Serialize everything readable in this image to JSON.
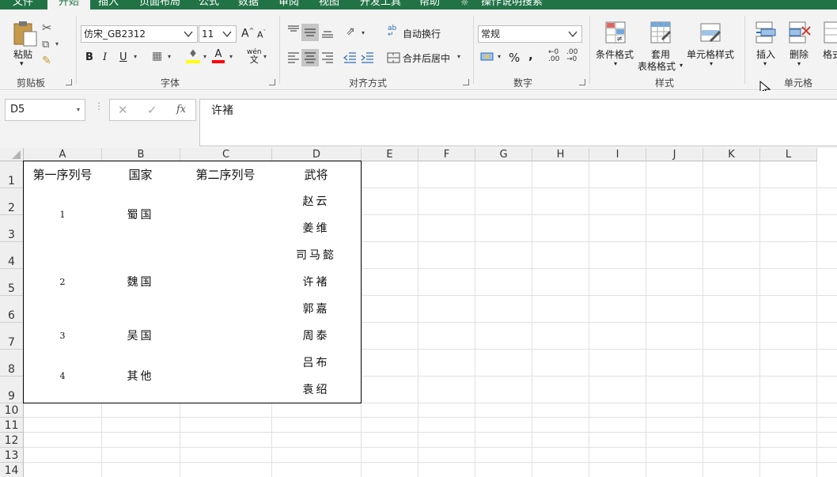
{
  "ribbon": {
    "tabs": [
      "文件",
      "开始",
      "插入",
      "页面布局",
      "公式",
      "数据",
      "审阅",
      "视图",
      "开发工具",
      "帮助"
    ],
    "active_tab": "开始",
    "tell_me": "操作说明搜索",
    "clipboard": {
      "paste": "粘贴",
      "group": "剪贴板"
    },
    "font": {
      "name": "仿宋_GB2312",
      "size": "11",
      "bold": "B",
      "italic": "I",
      "underline": "U",
      "wen": "wén",
      "group": "字体"
    },
    "alignment": {
      "wrap": "自动换行",
      "merge": "合并后居中",
      "group": "对齐方式"
    },
    "number": {
      "format": "常规",
      "percent": "%",
      "comma": ",",
      "group": "数字"
    },
    "styles": {
      "conditional": "条件格式",
      "table_line1": "套用",
      "table_line2": "表格格式",
      "cell_styles": "单元格样式",
      "group": "样式"
    },
    "cells": {
      "insert": "插入",
      "delete": "删除",
      "format": "格式",
      "group": "单元格"
    }
  },
  "formula_bar": {
    "name_box": "D5",
    "fx": "fx",
    "content": "许褚"
  },
  "columns": [
    "A",
    "B",
    "C",
    "D",
    "E",
    "F",
    "G",
    "H",
    "I",
    "J",
    "K",
    "L"
  ],
  "rows": [
    "1",
    "2",
    "3",
    "4",
    "5",
    "6",
    "7",
    "8",
    "9",
    "10",
    "11",
    "12",
    "13",
    "14"
  ],
  "table": {
    "headers": [
      "第一序列号",
      "国家",
      "第二序列号",
      "武将"
    ],
    "groups": [
      {
        "seq": "1",
        "country": "蜀国"
      },
      {
        "seq": "2",
        "country": "魏国"
      },
      {
        "seq": "3",
        "country": "吴国"
      },
      {
        "seq": "4",
        "country": "其他"
      }
    ],
    "generals": [
      "赵云",
      "姜维",
      "司马懿",
      "许褚",
      "郭嘉",
      "周泰",
      "吕布",
      "袁绍"
    ]
  },
  "colors": {
    "accent": "#217346",
    "ribbon_bg": "#f3f3f3",
    "font_color_bar": "#ff0000",
    "fill_color_bar": "#ffff00"
  }
}
